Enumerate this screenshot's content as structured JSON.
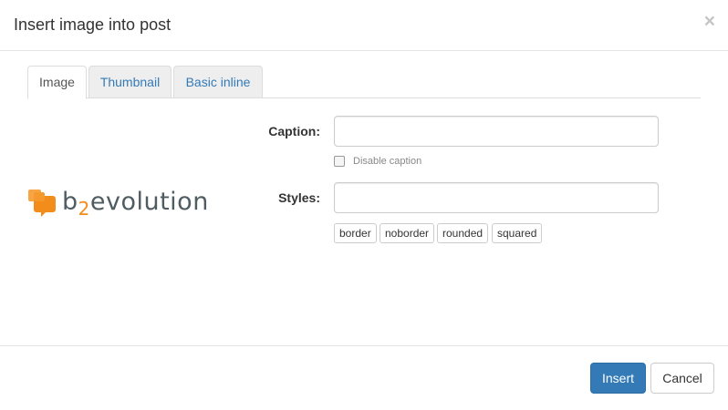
{
  "dialog": {
    "title": "Insert image into post",
    "close_symbol": "×"
  },
  "tabs": [
    {
      "label": "Image",
      "active": true
    },
    {
      "label": "Thumbnail",
      "active": false
    },
    {
      "label": "Basic inline",
      "active": false
    }
  ],
  "logo": {
    "icon": "chat-bubbles-icon",
    "text_before": "b",
    "text_sub": "2",
    "text_after": "evolution"
  },
  "form": {
    "caption_label": "Caption:",
    "caption_value": "",
    "disable_caption_label": "Disable caption",
    "disable_caption_checked": false,
    "styles_label": "Styles:",
    "styles_value": "",
    "style_options": [
      "border",
      "noborder",
      "rounded",
      "squared"
    ]
  },
  "footer": {
    "insert_label": "Insert",
    "cancel_label": "Cancel"
  },
  "colors": {
    "primary": "#337ab7",
    "tab_link": "#337ab7",
    "logo_orange": "#f28c1a",
    "logo_grey": "#4f5d62"
  }
}
